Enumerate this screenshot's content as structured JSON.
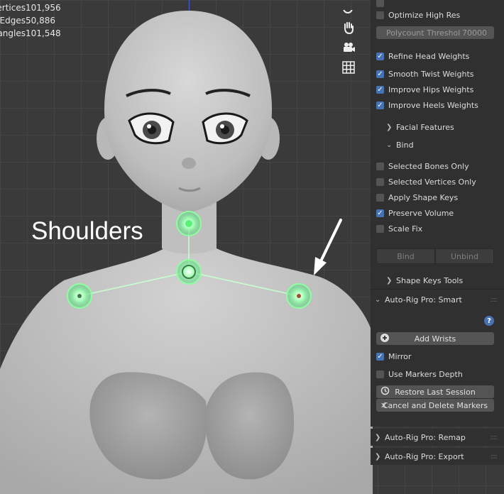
{
  "stats": [
    {
      "label": "Vertices",
      "value": "101,956"
    },
    {
      "label": "Edges",
      "value": "50,886"
    },
    {
      "label": "Triangles",
      "value": "101,548"
    }
  ],
  "annotation": {
    "label": "Shoulders"
  },
  "tools": [
    "zoom-icon",
    "hand-pan-icon",
    "camera-icon",
    "grid-icon"
  ],
  "panel": {
    "optimize_high_res": "Optimize High Res",
    "polycount_label": "Polycount Threshol",
    "polycount_value": "70000",
    "refine_head": "Refine Head Weights",
    "smooth_twist": "Smooth Twist Weights",
    "improve_hips": "Improve Hips Weights",
    "improve_heels": "Improve Heels Weights",
    "facial_features": "Facial Features",
    "bind_section": "Bind",
    "selected_bones_only": "Selected Bones Only",
    "selected_vertices_only": "Selected Vertices Only",
    "apply_shape_keys": "Apply Shape Keys",
    "preserve_volume": "Preserve Volume",
    "scale_fix": "Scale Fix",
    "bind_button": "Bind",
    "unbind_button": "Unbind",
    "shape_keys_tools": "Shape Keys Tools",
    "smart_panel": "Auto-Rig Pro: Smart",
    "help": "?",
    "add_wrists": "Add Wrists",
    "mirror": "Mirror",
    "use_markers_depth": "Use Markers Depth",
    "restore_last_session": "Restore Last Session",
    "cancel_delete_markers": "Cancel and Delete Markers",
    "remap_panel": "Auto-Rig Pro: Remap",
    "export_panel": "Auto-Rig Pro: Export"
  },
  "checks": {
    "optimize_high_res": false,
    "refine_head": true,
    "smooth_twist": true,
    "improve_hips": true,
    "improve_heels": true,
    "selected_bones_only": false,
    "selected_vertices_only": false,
    "apply_shape_keys": false,
    "preserve_volume": true,
    "scale_fix": false,
    "mirror": true,
    "use_markers_depth": false
  },
  "colors": {
    "accent": "#4772b3",
    "marker": "#7dff9a",
    "panel": "#303030"
  }
}
